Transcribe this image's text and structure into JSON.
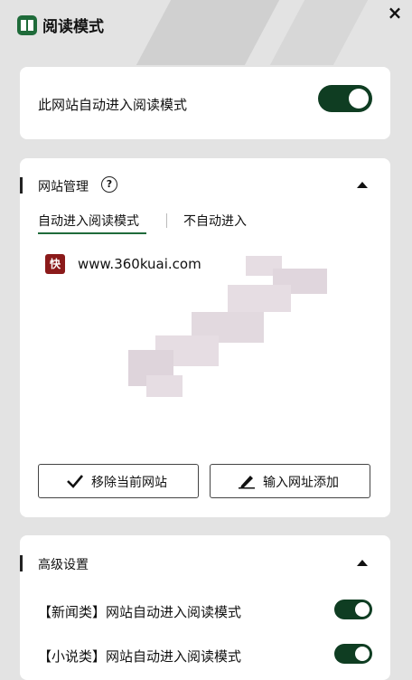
{
  "app": {
    "title": "阅读模式",
    "close_glyph": "×"
  },
  "auto_reader": {
    "label": "此网站自动进入阅读模式",
    "enabled": true
  },
  "site_management": {
    "title": "网站管理",
    "help_glyph": "?",
    "tabs": [
      {
        "label": "自动进入阅读模式",
        "active": true
      },
      {
        "label": "不自动进入",
        "active": false
      }
    ],
    "sites": [
      {
        "icon_text": "快",
        "url": "www.360kuai.com"
      }
    ],
    "remove_button": "移除当前网站",
    "add_button": "输入网址添加"
  },
  "advanced": {
    "title": "高级设置",
    "options": [
      {
        "label": "【新闻类】网站自动进入阅读模式",
        "enabled": true
      },
      {
        "label": "【小说类】网站自动进入阅读模式",
        "enabled": true
      }
    ]
  },
  "colors": {
    "accent": "#0f3d22",
    "brand": "#1f6b3a"
  }
}
